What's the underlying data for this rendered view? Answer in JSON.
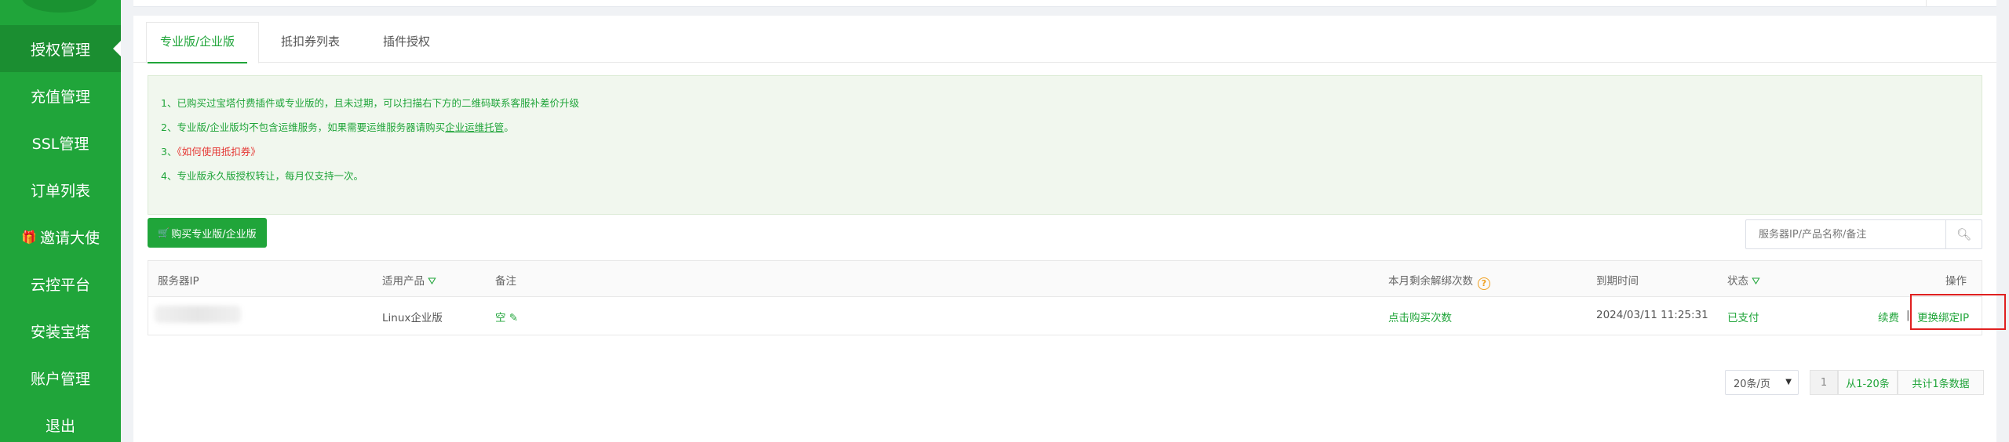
{
  "sidebar": {
    "items": [
      {
        "label": "授权管理",
        "active": true
      },
      {
        "label": "充值管理"
      },
      {
        "label": "SSL管理"
      },
      {
        "label": "订单列表"
      },
      {
        "label": "邀请大使",
        "icon": "gift-icon"
      },
      {
        "label": "云控平台"
      },
      {
        "label": "安装宝塔"
      },
      {
        "label": "账户管理"
      },
      {
        "label": "退出"
      }
    ]
  },
  "tabs": [
    {
      "label": "专业版/企业版",
      "active": true
    },
    {
      "label": "抵扣券列表"
    },
    {
      "label": "插件授权"
    }
  ],
  "notice": {
    "line1": "1、已购买过宝塔付费插件或专业版的，且未过期，可以扫描右下方的二维码联系客服补差价升级",
    "line2_prefix": "2、专业版/企业版均不包含运维服务，如果需要运维服务器请购买",
    "line2_link": "企业运维托管",
    "line2_suffix": "。",
    "line3_prefix": "3、",
    "line3_link": "《如何使用抵扣券》",
    "line4": "4、专业版永久版授权转让，每月仅支持一次。"
  },
  "buy_button": "购买专业版/企业版",
  "search": {
    "placeholder": "服务器IP/产品名称/备注"
  },
  "table": {
    "headers": {
      "ip": "服务器IP",
      "product": "适用产品",
      "remark": "备注",
      "remaining": "本月剩余解绑次数",
      "expire": "到期时间",
      "status": "状态",
      "action": "操作"
    },
    "rows": [
      {
        "ip": "",
        "product": "Linux企业版",
        "remark": "空",
        "remaining": "点击购买次数",
        "expire": "2024/03/11 11:25:31",
        "status": "已支付",
        "action_renew": "续费",
        "action_sep": "|",
        "action_change": "更换绑定IP"
      }
    ]
  },
  "pagination": {
    "page_size": "20条/页",
    "current_page": "1",
    "range": "从1-20条",
    "total": "共计1条数据"
  },
  "colors": {
    "accent": "#20a53a",
    "highlight_box": "#e02020",
    "warning": "#e53935"
  }
}
